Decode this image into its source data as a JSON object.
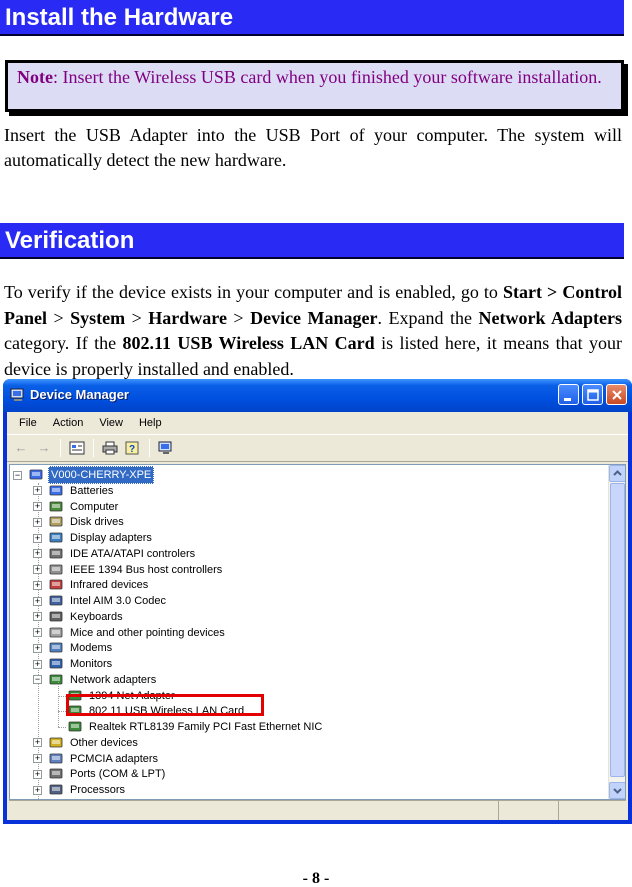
{
  "sections": {
    "install": {
      "title": "Install the Hardware",
      "note_label": "Note",
      "note_text": ": Insert the Wireless USB card when you finished your software installation.",
      "paragraph": "Insert the USB Adapter into the USB Port of your computer. The system will automatically detect the new hardware."
    },
    "verification": {
      "title": "Verification",
      "p_intro": "To verify if the device exists in your computer and is enabled, go to ",
      "path_start": "Start > Control Panel",
      "sep1": " > ",
      "path_system": "System",
      "sep2": " > ",
      "path_hardware": "Hardware",
      "sep3": " > ",
      "path_device_manager": "Device Manager",
      "p_mid": ". Expand the ",
      "network_adapters": "Network Adapters",
      "p_mid2": " category. If the ",
      "card_name": "802.11 USB Wireless LAN Card",
      "p_end": " is listed here, it means that your device is properly installed and enabled."
    }
  },
  "window": {
    "title": "Device Manager",
    "menu": [
      "File",
      "Action",
      "View",
      "Help"
    ],
    "toolbar_icons": [
      "back-arrow-icon",
      "forward-arrow-icon",
      "properties-icon",
      "print-icon",
      "help-icon",
      "scan-hardware-icon"
    ],
    "tree": {
      "root": "V000-CHERRY-XPE",
      "categories": [
        {
          "label": "Batteries",
          "expanded": false
        },
        {
          "label": "Computer",
          "expanded": false
        },
        {
          "label": "Disk drives",
          "expanded": false
        },
        {
          "label": "Display adapters",
          "expanded": false
        },
        {
          "label": "IDE ATA/ATAPI controlers",
          "expanded": false
        },
        {
          "label": "IEEE 1394 Bus host controllers",
          "expanded": false
        },
        {
          "label": "Infrared devices",
          "expanded": false
        },
        {
          "label": "Intel AIM 3.0 Codec",
          "expanded": false
        },
        {
          "label": "Keyboards",
          "expanded": false
        },
        {
          "label": "Mice and other pointing devices",
          "expanded": false
        },
        {
          "label": "Modems",
          "expanded": false
        },
        {
          "label": "Monitors",
          "expanded": false
        },
        {
          "label": "Network adapters",
          "expanded": true
        },
        {
          "label": "Other devices",
          "expanded": false
        },
        {
          "label": "PCMCIA adapters",
          "expanded": false
        },
        {
          "label": "Ports (COM & LPT)",
          "expanded": false
        },
        {
          "label": "Processors",
          "expanded": false
        }
      ],
      "network_children": [
        "1394 Net Adapter",
        "802.11 USB Wireless LAN Card",
        "Realtek RTL8139 Family PCI Fast Ethernet NIC"
      ]
    }
  },
  "page_number": "- 8 -"
}
